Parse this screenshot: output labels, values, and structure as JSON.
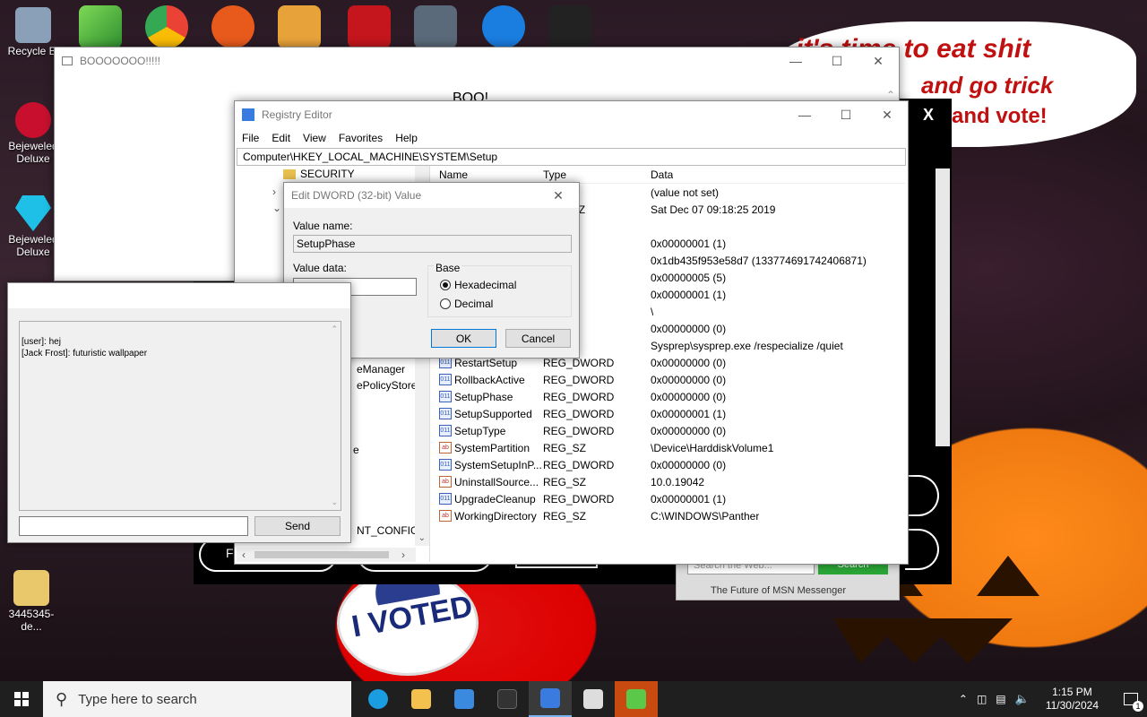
{
  "desktop": {
    "icons": [
      {
        "label": "Recycle Bi",
        "color": "#8aa0b8"
      },
      {
        "label": "Bejeweled Deluxe",
        "color": "#c8102e"
      },
      {
        "label": "Bejeweled Deluxe",
        "color": "#1ec0e8"
      },
      {
        "label": "3445345-de...",
        "color": "#e8c86a"
      }
    ],
    "wallpaper_text": {
      "line1": "it's time to eat shit",
      "line2": "and go trick",
      "line3": "and vote!",
      "pin": "I VOTED"
    }
  },
  "boo_window": {
    "title": "BOOOOOOO!!!!!",
    "heading": "BOO!"
  },
  "registry": {
    "title": "Registry Editor",
    "menu": [
      "File",
      "Edit",
      "View",
      "Favorites",
      "Help"
    ],
    "address": "Computer\\HKEY_LOCAL_MACHINE\\SYSTEM\\Setup",
    "tree_items": [
      "SECURITY",
      "eManager",
      "ePolicyStore",
      "e",
      "NT_CONFIG"
    ],
    "columns": {
      "name": "Name",
      "type": "Type",
      "data": "Data"
    },
    "partial_rows": [
      {
        "type": "",
        "data": "(value not set)"
      },
      {
        "type": "ULTI_SZ",
        "data": "Sat Dec 07 09:18:25 2019"
      },
      {
        "type": "",
        "data": ""
      },
      {
        "type": "WORD",
        "data": "0x00000001 (1)"
      },
      {
        "type": "WORD",
        "data": "0x1db435f953e58d7 (133774691742406871)"
      },
      {
        "type": "WORD",
        "data": "0x00000005 (5)"
      },
      {
        "type": "WORD",
        "data": "0x00000001 (1)"
      },
      {
        "type": "",
        "data": "\\"
      },
      {
        "type": "WORD",
        "data": "0x00000000 (0)"
      },
      {
        "type": "",
        "data": "Sysprep\\sysprep.exe /respecialize /quiet"
      }
    ],
    "rows": [
      {
        "name": "RestartSetup",
        "type": "REG_DWORD",
        "data": "0x00000000 (0)",
        "kind": "dw"
      },
      {
        "name": "RollbackActive",
        "type": "REG_DWORD",
        "data": "0x00000000 (0)",
        "kind": "dw"
      },
      {
        "name": "SetupPhase",
        "type": "REG_DWORD",
        "data": "0x00000000 (0)",
        "kind": "dw"
      },
      {
        "name": "SetupSupported",
        "type": "REG_DWORD",
        "data": "0x00000001 (1)",
        "kind": "dw"
      },
      {
        "name": "SetupType",
        "type": "REG_DWORD",
        "data": "0x00000000 (0)",
        "kind": "dw"
      },
      {
        "name": "SystemPartition",
        "type": "REG_SZ",
        "data": "\\Device\\HarddiskVolume1",
        "kind": "sz"
      },
      {
        "name": "SystemSetupInP...",
        "type": "REG_DWORD",
        "data": "0x00000000 (0)",
        "kind": "dw"
      },
      {
        "name": "UninstallSource...",
        "type": "REG_SZ",
        "data": "10.0.19042",
        "kind": "sz"
      },
      {
        "name": "UpgradeCleanup",
        "type": "REG_DWORD",
        "data": "0x00000001 (1)",
        "kind": "dw"
      },
      {
        "name": "WorkingDirectory",
        "type": "REG_SZ",
        "data": "C:\\WINDOWS\\Panther",
        "kind": "sz"
      }
    ]
  },
  "dword_dialog": {
    "title": "Edit DWORD (32-bit) Value",
    "value_name_label": "Value name:",
    "value_name": "SetupPhase",
    "value_data_label": "Value data:",
    "value_data": "",
    "base_label": "Base",
    "hex_label": "Hexadecimal",
    "dec_label": "Decimal",
    "ok": "OK",
    "cancel": "Cancel"
  },
  "chat": {
    "messages": [
      "[user]: hej",
      "[Jack Frost]: futuristic wallpaper"
    ],
    "input_value": "",
    "send": "Send"
  },
  "msn": {
    "search_placeholder": "Search the Web...",
    "search_btn": "Search",
    "footer": "The Future of MSN Messenger"
  },
  "overlay": {
    "close": "X",
    "btn_partial": "Fi"
  },
  "taskbar": {
    "search_placeholder": "Type here to search",
    "time": "1:15 PM",
    "date": "11/30/2024",
    "notif_count": "1"
  }
}
